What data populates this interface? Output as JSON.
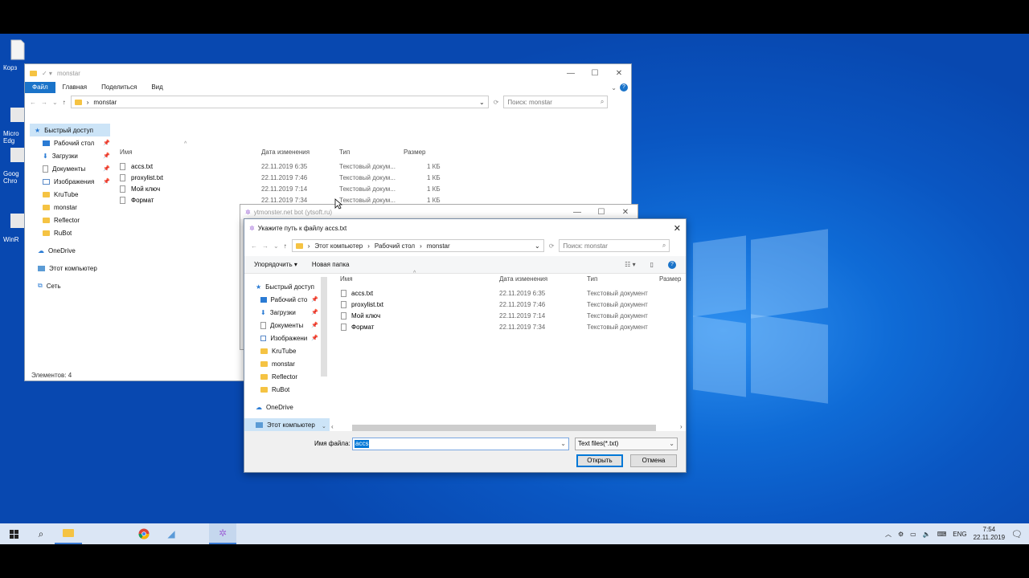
{
  "desktop": {
    "icons": [
      {
        "label": "Корз"
      },
      {
        "label": "Micro Edg"
      },
      {
        "label": "Goog Chro"
      },
      {
        "label": "WinR"
      }
    ]
  },
  "explorer": {
    "title": "monstar",
    "ribbon_tabs": [
      "Файл",
      "Главная",
      "Поделиться",
      "Вид"
    ],
    "address": "monstar",
    "search_placeholder": "Поиск: monstar",
    "nav": [
      {
        "label": "Быстрый доступ",
        "pinned": false
      },
      {
        "label": "Рабочий стол",
        "pinned": true
      },
      {
        "label": "Загрузки",
        "pinned": true
      },
      {
        "label": "Документы",
        "pinned": true
      },
      {
        "label": "Изображения",
        "pinned": true
      },
      {
        "label": "KruTube",
        "pinned": false
      },
      {
        "label": "monstar",
        "pinned": false
      },
      {
        "label": "Reflector",
        "pinned": false
      },
      {
        "label": "RuBot",
        "pinned": false
      },
      {
        "label": "OneDrive",
        "pinned": false
      },
      {
        "label": "Этот компьютер",
        "pinned": false
      },
      {
        "label": "Сеть",
        "pinned": false
      }
    ],
    "columns": [
      "Имя",
      "Дата изменения",
      "Тип",
      "Размер"
    ],
    "files": [
      {
        "name": "accs.txt",
        "date": "22.11.2019 6:35",
        "type": "Текстовый докум...",
        "size": "1 КБ"
      },
      {
        "name": "proxylist.txt",
        "date": "22.11.2019 7:46",
        "type": "Текстовый докум...",
        "size": "1 КБ"
      },
      {
        "name": "Мой ключ",
        "date": "22.11.2019 7:14",
        "type": "Текстовый докум...",
        "size": "1 КБ"
      },
      {
        "name": "Формат",
        "date": "22.11.2019 7:34",
        "type": "Текстовый докум...",
        "size": "1 КБ"
      }
    ],
    "status": "Элементов: 4"
  },
  "ytmonster": {
    "title": "ytmonster.net bot (ytsoft.ru)"
  },
  "dialog": {
    "title": "Укажите путь к файлу accs.txt",
    "breadcrumb": [
      "Этот компьютер",
      "Рабочий стол",
      "monstar"
    ],
    "search_placeholder": "Поиск: monstar",
    "organize_label": "Упорядочить ▾",
    "new_folder_label": "Новая папка",
    "nav": [
      {
        "label": "Быстрый доступ",
        "pinned": false
      },
      {
        "label": "Рабочий сто",
        "pinned": true
      },
      {
        "label": "Загрузки",
        "pinned": true
      },
      {
        "label": "Документы",
        "pinned": true
      },
      {
        "label": "Изображени",
        "pinned": true
      },
      {
        "label": "KruTube",
        "pinned": false
      },
      {
        "label": "monstar",
        "pinned": false
      },
      {
        "label": "Reflector",
        "pinned": false
      },
      {
        "label": "RuBot",
        "pinned": false
      },
      {
        "label": "OneDrive",
        "pinned": false
      },
      {
        "label": "Этот компьютер",
        "pinned": false
      }
    ],
    "columns": [
      "Имя",
      "Дата изменения",
      "Тип",
      "Размер"
    ],
    "files": [
      {
        "name": "accs.txt",
        "date": "22.11.2019 6:35",
        "type": "Текстовый документ"
      },
      {
        "name": "proxylist.txt",
        "date": "22.11.2019 7:46",
        "type": "Текстовый документ"
      },
      {
        "name": "Мой ключ",
        "date": "22.11.2019 7:14",
        "type": "Текстовый документ"
      },
      {
        "name": "Формат",
        "date": "22.11.2019 7:34",
        "type": "Текстовый документ"
      }
    ],
    "filename_label": "Имя файла:",
    "filename_value": "accs",
    "filter_value": "Text files(*.txt)",
    "open_label": "Открыть",
    "cancel_label": "Отмена"
  },
  "taskbar": {
    "lang": "ENG",
    "time": "7:54",
    "date": "22.11.2019"
  },
  "colors": {
    "accent": "#0078d7",
    "desktop": "#0a56c2",
    "taskbar": "#dbe6f5"
  }
}
